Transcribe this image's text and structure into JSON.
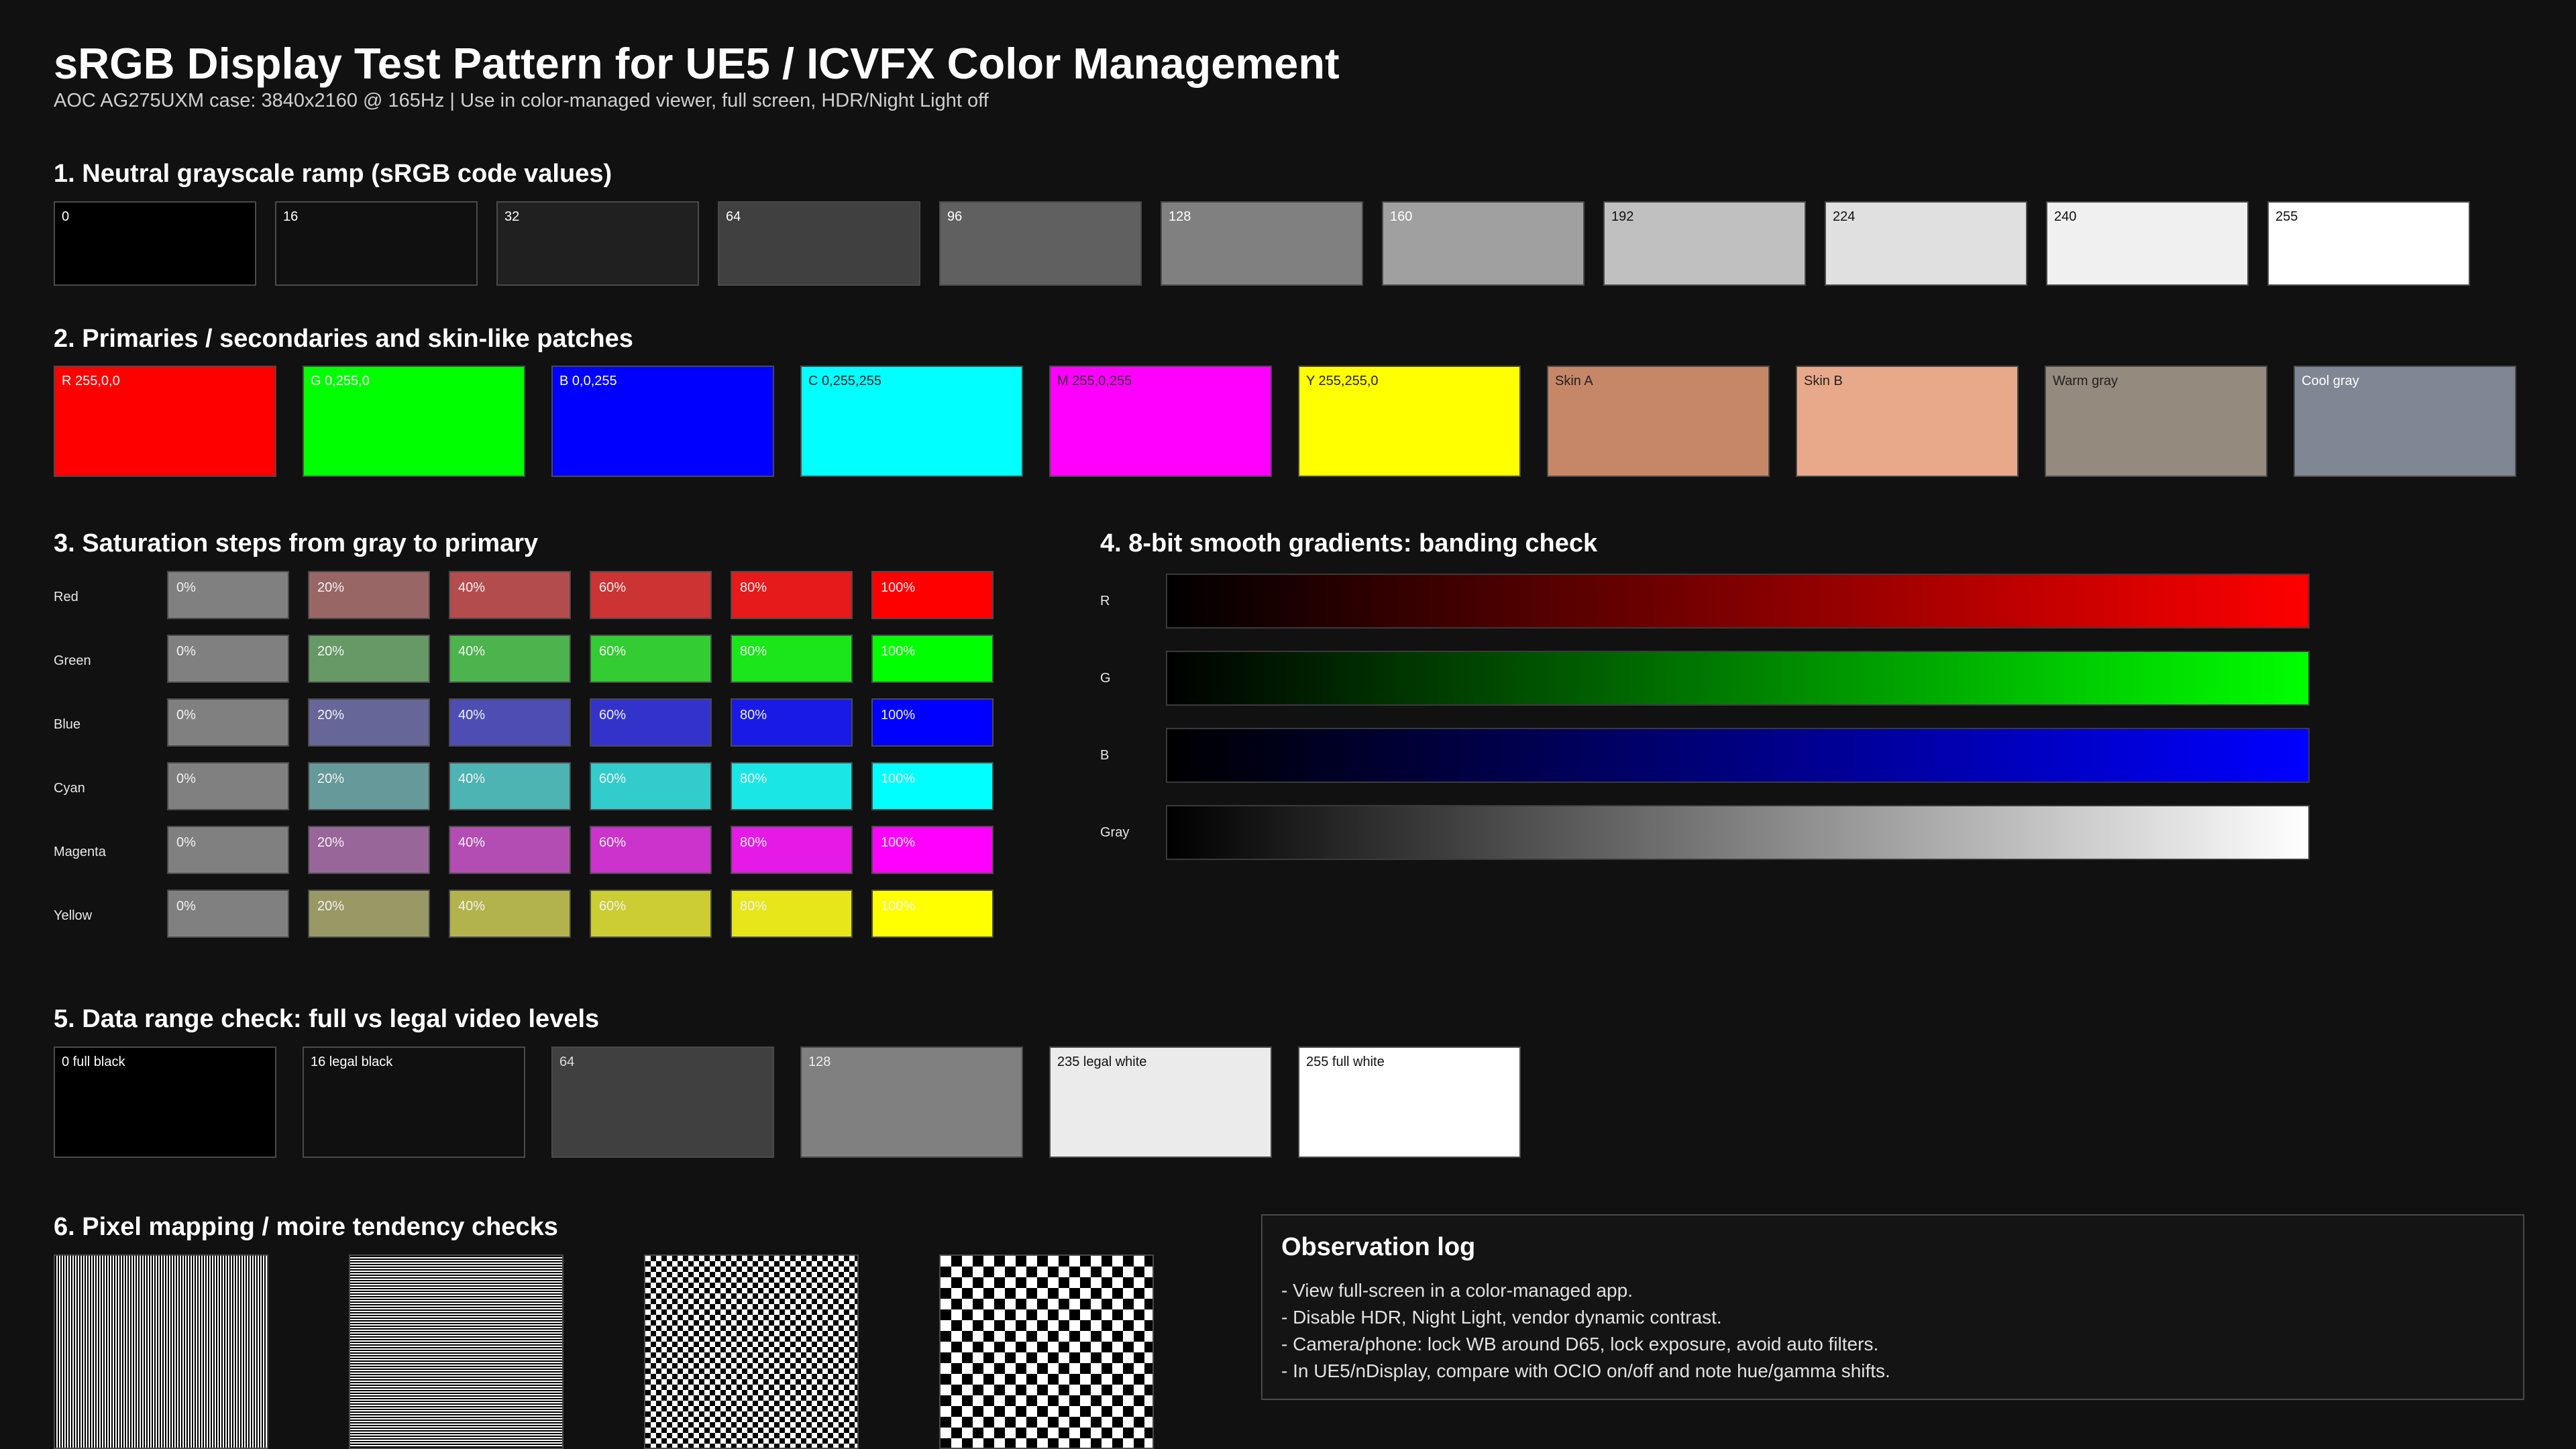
{
  "header": {
    "title": "sRGB Display Test Pattern for UE5 / ICVFX Color Management",
    "subtitle": "AOC AG275UXM case: 3840x2160 @ 165Hz | Use in color-managed viewer, full screen, HDR/Night Light off"
  },
  "section1": {
    "title": "1. Neutral grayscale ramp (sRGB code values)",
    "patches": [
      {
        "label": "0",
        "color": "#000000"
      },
      {
        "label": "16",
        "color": "#101010"
      },
      {
        "label": "32",
        "color": "#202020"
      },
      {
        "label": "64",
        "color": "#404040"
      },
      {
        "label": "96",
        "color": "#606060"
      },
      {
        "label": "128",
        "color": "#808080"
      },
      {
        "label": "160",
        "color": "#a0a0a0"
      },
      {
        "label": "192",
        "color": "#c0c0c0"
      },
      {
        "label": "224",
        "color": "#e0e0e0"
      },
      {
        "label": "240",
        "color": "#f0f0f0"
      },
      {
        "label": "255",
        "color": "#ffffff"
      }
    ]
  },
  "section2": {
    "title": "2. Primaries / secondaries and skin-like patches",
    "patches": [
      {
        "label": "R 255,0,0",
        "color": "#ff0000",
        "text_color": "#ffffff"
      },
      {
        "label": "G 0,255,0",
        "color": "#00ff00",
        "text_color": "#ffffff"
      },
      {
        "label": "B 0,0,255",
        "color": "#0000ff",
        "text_color": "#ffffff"
      },
      {
        "label": "C 0,255,255",
        "color": "#00ffff",
        "text_color": "#222222"
      },
      {
        "label": "M 255,0,255",
        "color": "#ff00ff",
        "text_color": "#333333"
      },
      {
        "label": "Y 255,255,0",
        "color": "#ffff00",
        "text_color": "#222222"
      },
      {
        "label": "Skin A",
        "color": "#c68768",
        "text_color": "#222222"
      },
      {
        "label": "Skin B",
        "color": "#e7a98a",
        "text_color": "#222222"
      },
      {
        "label": "Warm gray",
        "color": "#948a7e",
        "text_color": "#222222"
      },
      {
        "label": "Cool gray",
        "color": "#7e8793",
        "text_color": "#ffffff"
      }
    ]
  },
  "section3": {
    "title": "3. Saturation steps from gray to primary",
    "steps": [
      "0%",
      "20%",
      "40%",
      "60%",
      "80%",
      "100%"
    ],
    "rows": [
      {
        "name": "Red",
        "colors": [
          "#808080",
          "#996666",
          "#b34d4d",
          "#cc3333",
          "#e61a1a",
          "#ff0000"
        ]
      },
      {
        "name": "Green",
        "colors": [
          "#808080",
          "#669966",
          "#4db34d",
          "#33cc33",
          "#1ae61a",
          "#00ff00"
        ]
      },
      {
        "name": "Blue",
        "colors": [
          "#808080",
          "#666699",
          "#4d4db3",
          "#3333cc",
          "#1a1ae6",
          "#0000ff"
        ]
      },
      {
        "name": "Cyan",
        "colors": [
          "#808080",
          "#669999",
          "#4db3b3",
          "#33cccc",
          "#1ae6e6",
          "#00ffff"
        ]
      },
      {
        "name": "Magenta",
        "colors": [
          "#808080",
          "#996699",
          "#b34db3",
          "#cc33cc",
          "#e61ae6",
          "#ff00ff"
        ]
      },
      {
        "name": "Yellow",
        "colors": [
          "#808080",
          "#999966",
          "#b3b34d",
          "#cccc33",
          "#e6e61a",
          "#ffff00"
        ]
      }
    ]
  },
  "section4": {
    "title": "4. 8-bit smooth gradients: banding check",
    "gradients": [
      {
        "name": "R",
        "end_color": "#ff0000"
      },
      {
        "name": "G",
        "end_color": "#00ff00"
      },
      {
        "name": "B",
        "end_color": "#0000ff"
      },
      {
        "name": "Gray",
        "end_color": "#ffffff"
      }
    ]
  },
  "section5": {
    "title": "5. Data range check: full vs legal video levels",
    "patches": [
      {
        "label": "0 full black",
        "color": "#000000",
        "text_color": "#ffffff"
      },
      {
        "label": "16 legal black",
        "color": "#101010",
        "text_color": "#ffffff"
      },
      {
        "label": "64",
        "color": "#404040",
        "text_color": "#dddddd"
      },
      {
        "label": "128",
        "color": "#808080",
        "text_color": "#eeeeee"
      },
      {
        "label": "235 legal white",
        "color": "#ebebeb",
        "text_color": "#111111"
      },
      {
        "label": "255 full white",
        "color": "#ffffff",
        "text_color": "#111111"
      }
    ]
  },
  "section6": {
    "title": "6. Pixel mapping / moire tendency checks",
    "patterns": [
      "fine-lines",
      "fine-lines",
      "checker-fine",
      "checker-coarse"
    ]
  },
  "observation_log": {
    "title": "Observation log",
    "lines": [
      "- View full-screen in a color-managed app.",
      "- Disable HDR, Night Light, vendor dynamic contrast.",
      "- Camera/phone: lock WB around D65, lock exposure, avoid auto filters.",
      "- In UE5/nDisplay, compare with OCIO on/off and note hue/gamma shifts."
    ]
  }
}
